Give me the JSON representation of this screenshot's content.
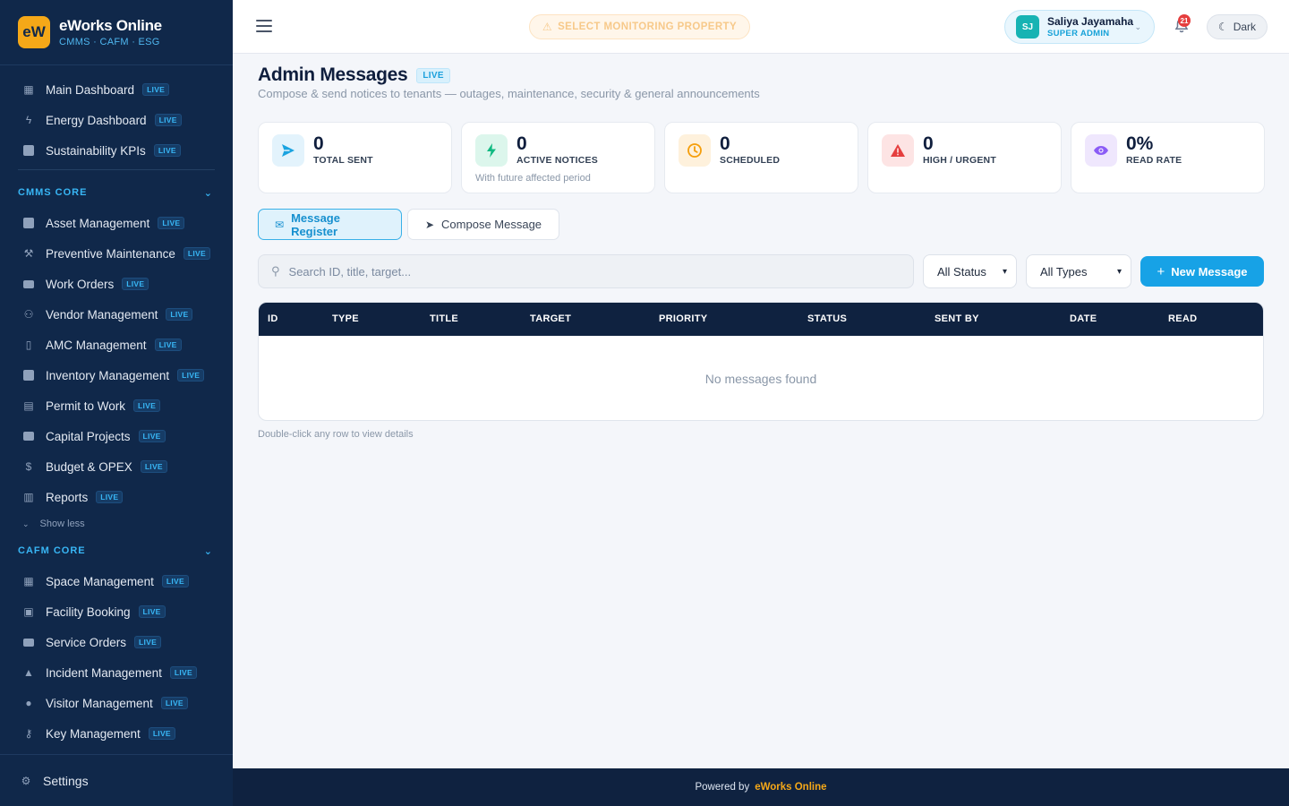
{
  "brand": {
    "logo": "eW",
    "name": "eWorks Online",
    "tagline": "CMMS · CAFM · ESG"
  },
  "sidebar": {
    "live_label": "LIVE",
    "top_items": [
      {
        "label": "Main Dashboard",
        "icon": "dashboard-icon"
      },
      {
        "label": "Energy Dashboard",
        "icon": "bolt-icon"
      },
      {
        "label": "Sustainability KPIs",
        "icon": "document-icon"
      }
    ],
    "cmms": {
      "title": "CMMS CORE",
      "items": [
        {
          "label": "Asset Management",
          "icon": "asset-icon"
        },
        {
          "label": "Preventive Maintenance",
          "icon": "wrench-icon"
        },
        {
          "label": "Work Orders",
          "icon": "ticket-icon"
        },
        {
          "label": "Vendor Management",
          "icon": "people-icon"
        },
        {
          "label": "AMC Management",
          "icon": "file-icon"
        },
        {
          "label": "Inventory Management",
          "icon": "inventory-icon"
        },
        {
          "label": "Permit to Work",
          "icon": "permit-icon"
        },
        {
          "label": "Capital Projects",
          "icon": "briefcase-icon"
        },
        {
          "label": "Budget & OPEX",
          "icon": "dollar-icon"
        },
        {
          "label": "Reports",
          "icon": "chart-icon"
        }
      ],
      "show_less": "Show less"
    },
    "cafm": {
      "title": "CAFM CORE",
      "items": [
        {
          "label": "Space Management",
          "icon": "building-icon"
        },
        {
          "label": "Facility Booking",
          "icon": "calendar-icon"
        },
        {
          "label": "Service Orders",
          "icon": "service-icon"
        },
        {
          "label": "Incident Management",
          "icon": "warning-icon"
        },
        {
          "label": "Visitor Management",
          "icon": "person-icon"
        },
        {
          "label": "Key Management",
          "icon": "key-icon"
        }
      ]
    },
    "settings": "Settings"
  },
  "topbar": {
    "property_label": "SELECT MONITORING PROPERTY",
    "user": {
      "initials": "SJ",
      "name": "Saliya Jayamaha",
      "role": "SUPER ADMIN"
    },
    "notifications": "21",
    "theme_label": "Dark"
  },
  "page": {
    "title": "Admin Messages",
    "live": "LIVE",
    "subtitle": "Compose & send notices to tenants — outages, maintenance, security & general announcements"
  },
  "stats": [
    {
      "value": "0",
      "label": "TOTAL SENT",
      "note": "",
      "icon": "send-icon",
      "color": "#1aa3e0",
      "bg": "#e3f3fc"
    },
    {
      "value": "0",
      "label": "ACTIVE NOTICES",
      "note": "With future affected period",
      "icon": "bolt-icon",
      "color": "#10b981",
      "bg": "#dcf6ec"
    },
    {
      "value": "0",
      "label": "SCHEDULED",
      "note": "",
      "icon": "clock-icon",
      "color": "#f59e0b",
      "bg": "#fef1dc"
    },
    {
      "value": "0",
      "label": "HIGH / URGENT",
      "note": "",
      "icon": "alert-icon",
      "color": "#e53e3e",
      "bg": "#fde4e4"
    },
    {
      "value": "0%",
      "label": "READ RATE",
      "note": "",
      "icon": "eye-icon",
      "color": "#8b5cf6",
      "bg": "#efe7fd"
    }
  ],
  "tabs": {
    "register": "Message Register",
    "compose": "Compose Message"
  },
  "filters": {
    "search_placeholder": "Search ID, title, target...",
    "status": "All Status",
    "types": "All Types",
    "new_button": "New Message"
  },
  "table": {
    "columns": [
      "ID",
      "TYPE",
      "TITLE",
      "TARGET",
      "PRIORITY",
      "STATUS",
      "SENT BY",
      "DATE",
      "READ"
    ],
    "empty": "No messages found",
    "hint": "Double-click any row to view details"
  },
  "footer": {
    "prefix": "Powered by",
    "brand": "eWorks Online"
  }
}
